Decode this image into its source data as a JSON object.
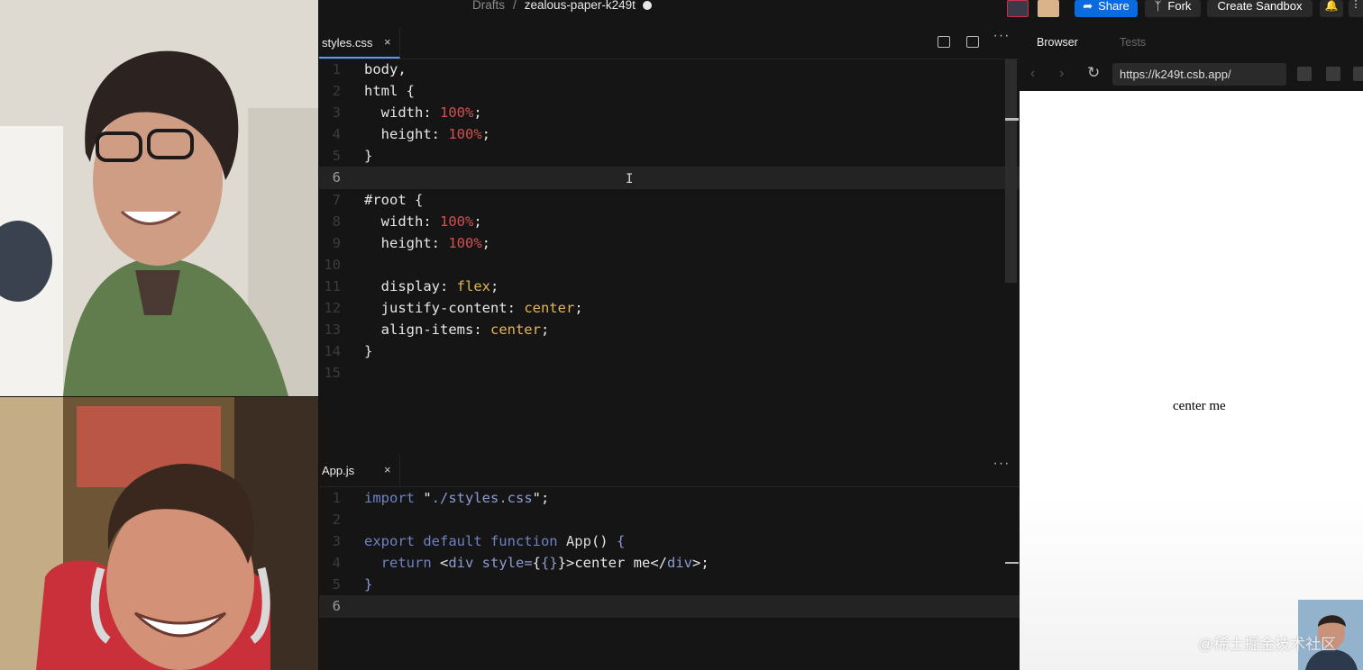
{
  "topbar": {
    "breadcrumb_root": "Drafts",
    "breadcrumb_sep": "/",
    "project_name": "zealous-paper-k249t",
    "share_label": "Share",
    "fork_label": "Fork",
    "create_sandbox_label": "Create Sandbox",
    "share_icon": "share-arrow-icon",
    "fork_icon": "fork-icon",
    "bell_icon": "bell-icon",
    "accent_color": "#0a6be0"
  },
  "editor": {
    "top_tab": {
      "label": "styles.css",
      "close": "×"
    },
    "bottom_tab": {
      "label": "App.js",
      "close": "×"
    },
    "more_glyph": "···",
    "css_lines": [
      {
        "n": "1",
        "parts": [
          [
            "sel",
            "body,"
          ]
        ]
      },
      {
        "n": "2",
        "parts": [
          [
            "sel",
            "html {"
          ]
        ]
      },
      {
        "n": "3",
        "parts": [
          [
            "sel",
            "  width: "
          ],
          [
            "val",
            "100%"
          ],
          [
            "sel",
            ";"
          ]
        ]
      },
      {
        "n": "4",
        "parts": [
          [
            "sel",
            "  height: "
          ],
          [
            "val",
            "100%"
          ],
          [
            "sel",
            ";"
          ]
        ]
      },
      {
        "n": "5",
        "parts": [
          [
            "sel",
            "}"
          ]
        ]
      },
      {
        "n": "6",
        "parts": [],
        "active": true,
        "cursor": true
      },
      {
        "n": "7",
        "parts": [
          [
            "sel",
            "#root {"
          ]
        ]
      },
      {
        "n": "8",
        "parts": [
          [
            "sel",
            "  width: "
          ],
          [
            "val",
            "100%"
          ],
          [
            "sel",
            ";"
          ]
        ]
      },
      {
        "n": "9",
        "parts": [
          [
            "sel",
            "  height: "
          ],
          [
            "val",
            "100%"
          ],
          [
            "sel",
            ";"
          ]
        ]
      },
      {
        "n": "10",
        "parts": []
      },
      {
        "n": "11",
        "parts": [
          [
            "sel",
            "  display: "
          ],
          [
            "kwv",
            "flex"
          ],
          [
            "sel",
            ";"
          ]
        ]
      },
      {
        "n": "12",
        "parts": [
          [
            "sel",
            "  justify-content: "
          ],
          [
            "kwv",
            "center"
          ],
          [
            "sel",
            ";"
          ]
        ]
      },
      {
        "n": "13",
        "parts": [
          [
            "sel",
            "  align-items: "
          ],
          [
            "kwv",
            "center"
          ],
          [
            "sel",
            ";"
          ]
        ]
      },
      {
        "n": "14",
        "parts": [
          [
            "sel",
            "}"
          ]
        ]
      },
      {
        "n": "15",
        "parts": []
      }
    ],
    "js_lines": [
      {
        "n": "1",
        "parts": [
          [
            "kw",
            "import"
          ],
          [
            "sel",
            " \""
          ],
          [
            "str",
            "./styles.css"
          ],
          [
            "sel",
            "\";"
          ]
        ]
      },
      {
        "n": "2",
        "parts": []
      },
      {
        "n": "3",
        "parts": [
          [
            "kw",
            "export default function"
          ],
          [
            "fn",
            " App"
          ],
          [
            "sel",
            "() "
          ],
          [
            "op",
            "{"
          ]
        ]
      },
      {
        "n": "4",
        "parts": [
          [
            "kw",
            "  return"
          ],
          [
            "sel",
            " <"
          ],
          [
            "op",
            "div"
          ],
          [
            "str",
            " style"
          ],
          [
            "op",
            "="
          ],
          [
            "sel",
            "{"
          ],
          [
            "op",
            "{}"
          ],
          [
            "sel",
            "}>center me</"
          ],
          [
            "op",
            "div"
          ],
          [
            "sel",
            ">;"
          ]
        ]
      },
      {
        "n": "5",
        "parts": [
          [
            "op",
            "}"
          ]
        ]
      },
      {
        "n": "6",
        "parts": [],
        "active": true
      }
    ]
  },
  "browser": {
    "tab_browser": "Browser",
    "tab_tests": "Tests",
    "url": "https://k249t.csb.app/",
    "preview_text": "center me",
    "back_icon": "chevron-left-icon",
    "forward_icon": "chevron-right-icon",
    "reload_icon": "reload-icon"
  },
  "watermark": "@稀土掘金技术社区"
}
